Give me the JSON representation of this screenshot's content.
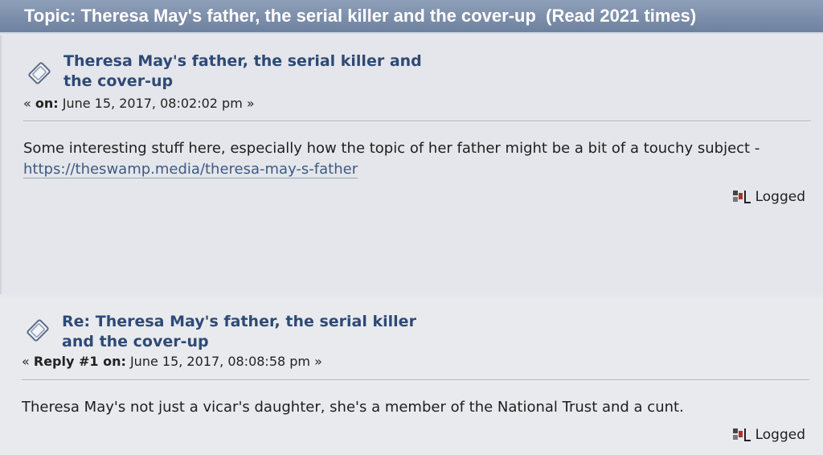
{
  "topic": {
    "title": "Topic: Theresa May's father, the serial killer and the cover-up  (Read 2021 times)"
  },
  "posts": [
    {
      "icon": "post-icon",
      "title": "Theresa May's father, the serial killer and the cover-up",
      "meta_prefix": "« ",
      "meta_label": "on:",
      "meta_date": " June 15, 2017, 08:02:02 pm »",
      "body": "Some interesting stuff here, especially how the topic of her father might be a bit of a touchy subject - ",
      "link": "https://theswamp.media/theresa-may-s-father",
      "status": "Logged"
    },
    {
      "icon": "post-icon",
      "title": "Re: Theresa May's father, the serial killer and the cover-up",
      "meta_prefix": "« ",
      "meta_label": "Reply #1 on:",
      "meta_date": " June 15, 2017, 08:08:58 pm »",
      "body": "Theresa May's not just a vicar's daughter, she's a member of the National Trust and a cunt.",
      "status": "Logged"
    }
  ],
  "colors": {
    "header_bar": "#7a8cab",
    "title": "#2e4a76",
    "link": "#3d5a83"
  },
  "icons": {
    "logged": "ip-logged-icon"
  }
}
